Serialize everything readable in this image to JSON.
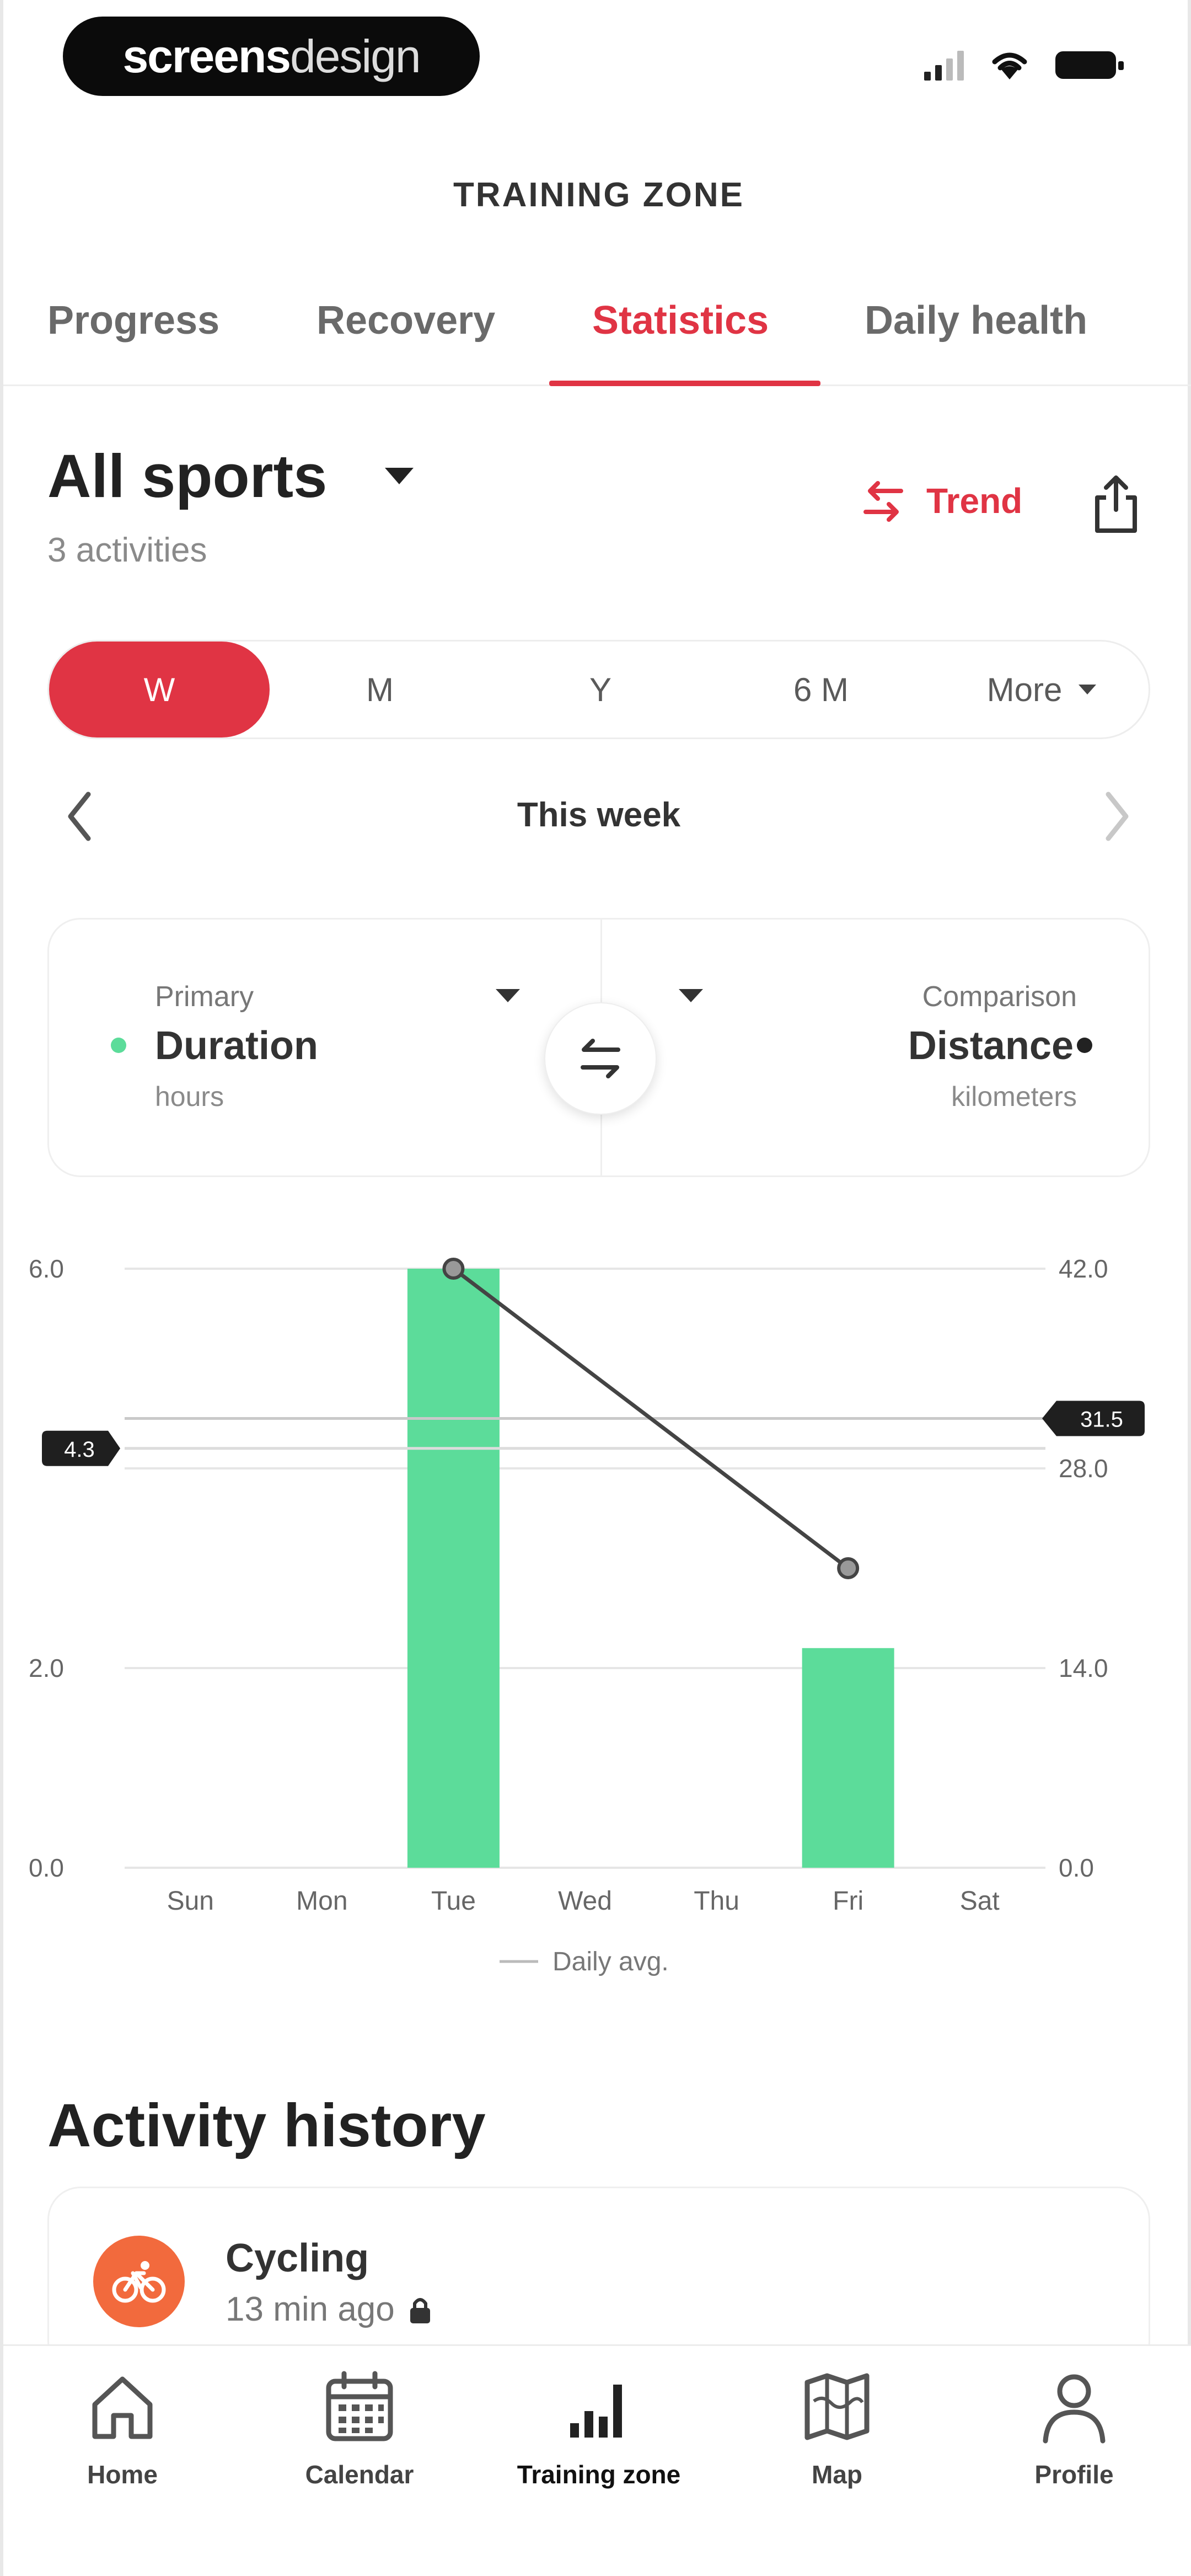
{
  "status_bar": {
    "logo_bold": "screens",
    "logo_light": "design",
    "icons": [
      "cellular-signal-icon",
      "wifi-icon",
      "battery-icon"
    ]
  },
  "page": {
    "title": "TRAINING ZONE"
  },
  "tabs": [
    {
      "label": "Progress",
      "active": false
    },
    {
      "label": "Recovery",
      "active": false
    },
    {
      "label": "Statistics",
      "active": true
    },
    {
      "label": "Daily health",
      "active": false
    }
  ],
  "sport": {
    "title": "All sports",
    "subtitle": "3 activities",
    "trend_label": "Trend"
  },
  "period_selector": {
    "options": [
      "W",
      "M",
      "Y",
      "6 M",
      "More"
    ],
    "selected": "W"
  },
  "week_nav": {
    "label": "This week"
  },
  "metrics": {
    "primary": {
      "label": "Primary",
      "name": "Duration",
      "unit": "hours",
      "color": "#5cdc9a"
    },
    "comparison": {
      "label": "Comparison",
      "name": "Distance",
      "unit": "kilometers",
      "color": "#222222"
    }
  },
  "chart_data": {
    "type": "bar",
    "categories": [
      "Sun",
      "Mon",
      "Tue",
      "Wed",
      "Thu",
      "Fri",
      "Sat"
    ],
    "series": [
      {
        "name": "Duration",
        "axis": "left",
        "kind": "bar",
        "color": "#5cdc9a",
        "values": [
          0,
          0,
          6.0,
          0,
          0,
          2.2,
          0
        ]
      },
      {
        "name": "Distance",
        "axis": "right",
        "kind": "line",
        "color": "#444444",
        "values": [
          null,
          null,
          42.0,
          null,
          null,
          21.0,
          null
        ]
      }
    ],
    "y_left": {
      "ticks": [
        "0.0",
        "2.0",
        "6.0"
      ],
      "ylim": [
        0,
        6.0
      ]
    },
    "y_right": {
      "ticks": [
        "0.0",
        "14.0",
        "28.0",
        "42.0"
      ],
      "ylim": [
        0,
        42.0
      ]
    },
    "avg_left": {
      "value": 4.2,
      "label": "4.3"
    },
    "avg_right": {
      "value": 31.5,
      "label": "31.5"
    },
    "legend": "Daily avg."
  },
  "activity_history": {
    "title": "Activity history",
    "items": [
      {
        "name": "Cycling",
        "time": "13 min ago",
        "icon": "cycling-icon",
        "color": "#f26a3d"
      }
    ]
  },
  "bottom_nav": [
    {
      "label": "Home",
      "icon": "home-icon",
      "active": false
    },
    {
      "label": "Calendar",
      "icon": "calendar-icon",
      "active": false
    },
    {
      "label": "Training zone",
      "icon": "bar-chart-icon",
      "active": true
    },
    {
      "label": "Map",
      "icon": "map-icon",
      "active": false
    },
    {
      "label": "Profile",
      "icon": "profile-icon",
      "active": false
    }
  ]
}
